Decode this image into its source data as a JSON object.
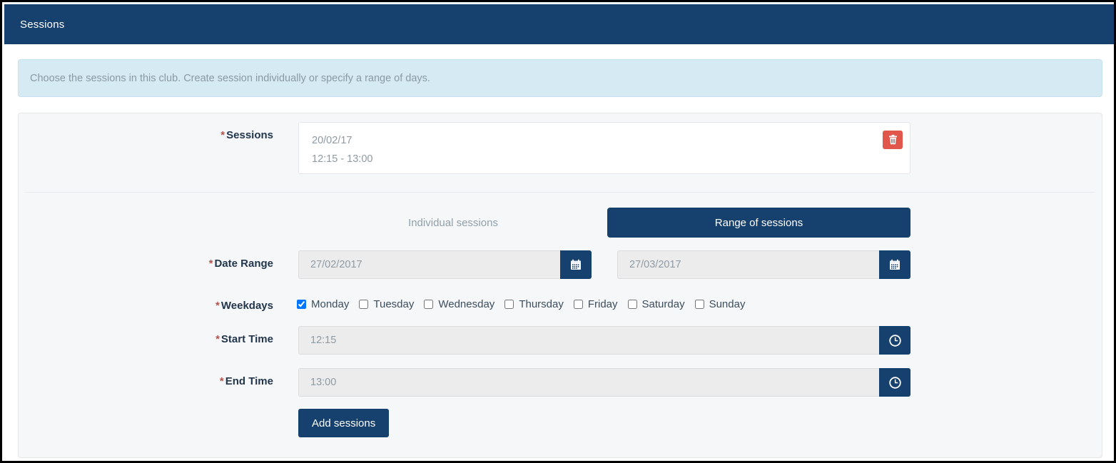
{
  "header": {
    "title": "Sessions"
  },
  "alert": {
    "text": "Choose the sessions in this club. Create session individually or specify a range of days."
  },
  "form": {
    "sessions": {
      "label": "Sessions",
      "required_mark": "*",
      "items": [
        {
          "date": "20/02/17",
          "time": "12:15 - 13:00",
          "delete_icon": "trash-icon"
        }
      ]
    },
    "tabs": [
      {
        "label": "Individual sessions",
        "active": false
      },
      {
        "label": "Range of sessions",
        "active": true
      }
    ],
    "date_range": {
      "label": "Date Range",
      "required_mark": "*",
      "start_value": "27/02/2017",
      "end_value": "27/03/2017",
      "start_placeholder": "27/02/2017",
      "end_placeholder": "27/03/2017",
      "icon": "calendar-icon"
    },
    "weekdays": {
      "label": "Weekdays",
      "required_mark": "*",
      "days": [
        {
          "label": "Monday",
          "checked": true
        },
        {
          "label": "Tuesday",
          "checked": false
        },
        {
          "label": "Wednesday",
          "checked": false
        },
        {
          "label": "Thursday",
          "checked": false
        },
        {
          "label": "Friday",
          "checked": false
        },
        {
          "label": "Saturday",
          "checked": false
        },
        {
          "label": "Sunday",
          "checked": false
        }
      ]
    },
    "start_time": {
      "label": "Start Time",
      "required_mark": "*",
      "value": "12:15",
      "placeholder": "12:15",
      "icon": "clock-icon"
    },
    "end_time": {
      "label": "End Time",
      "required_mark": "*",
      "value": "13:00",
      "placeholder": "13:00",
      "icon": "clock-icon"
    },
    "add_button": {
      "label": "Add sessions"
    }
  },
  "colors": {
    "brand_navy": "#16406e",
    "alert_bg": "#d5eaf3",
    "danger_red": "#e2574c",
    "panel_bg": "#f6f7f9",
    "required_red": "#b5534c"
  }
}
